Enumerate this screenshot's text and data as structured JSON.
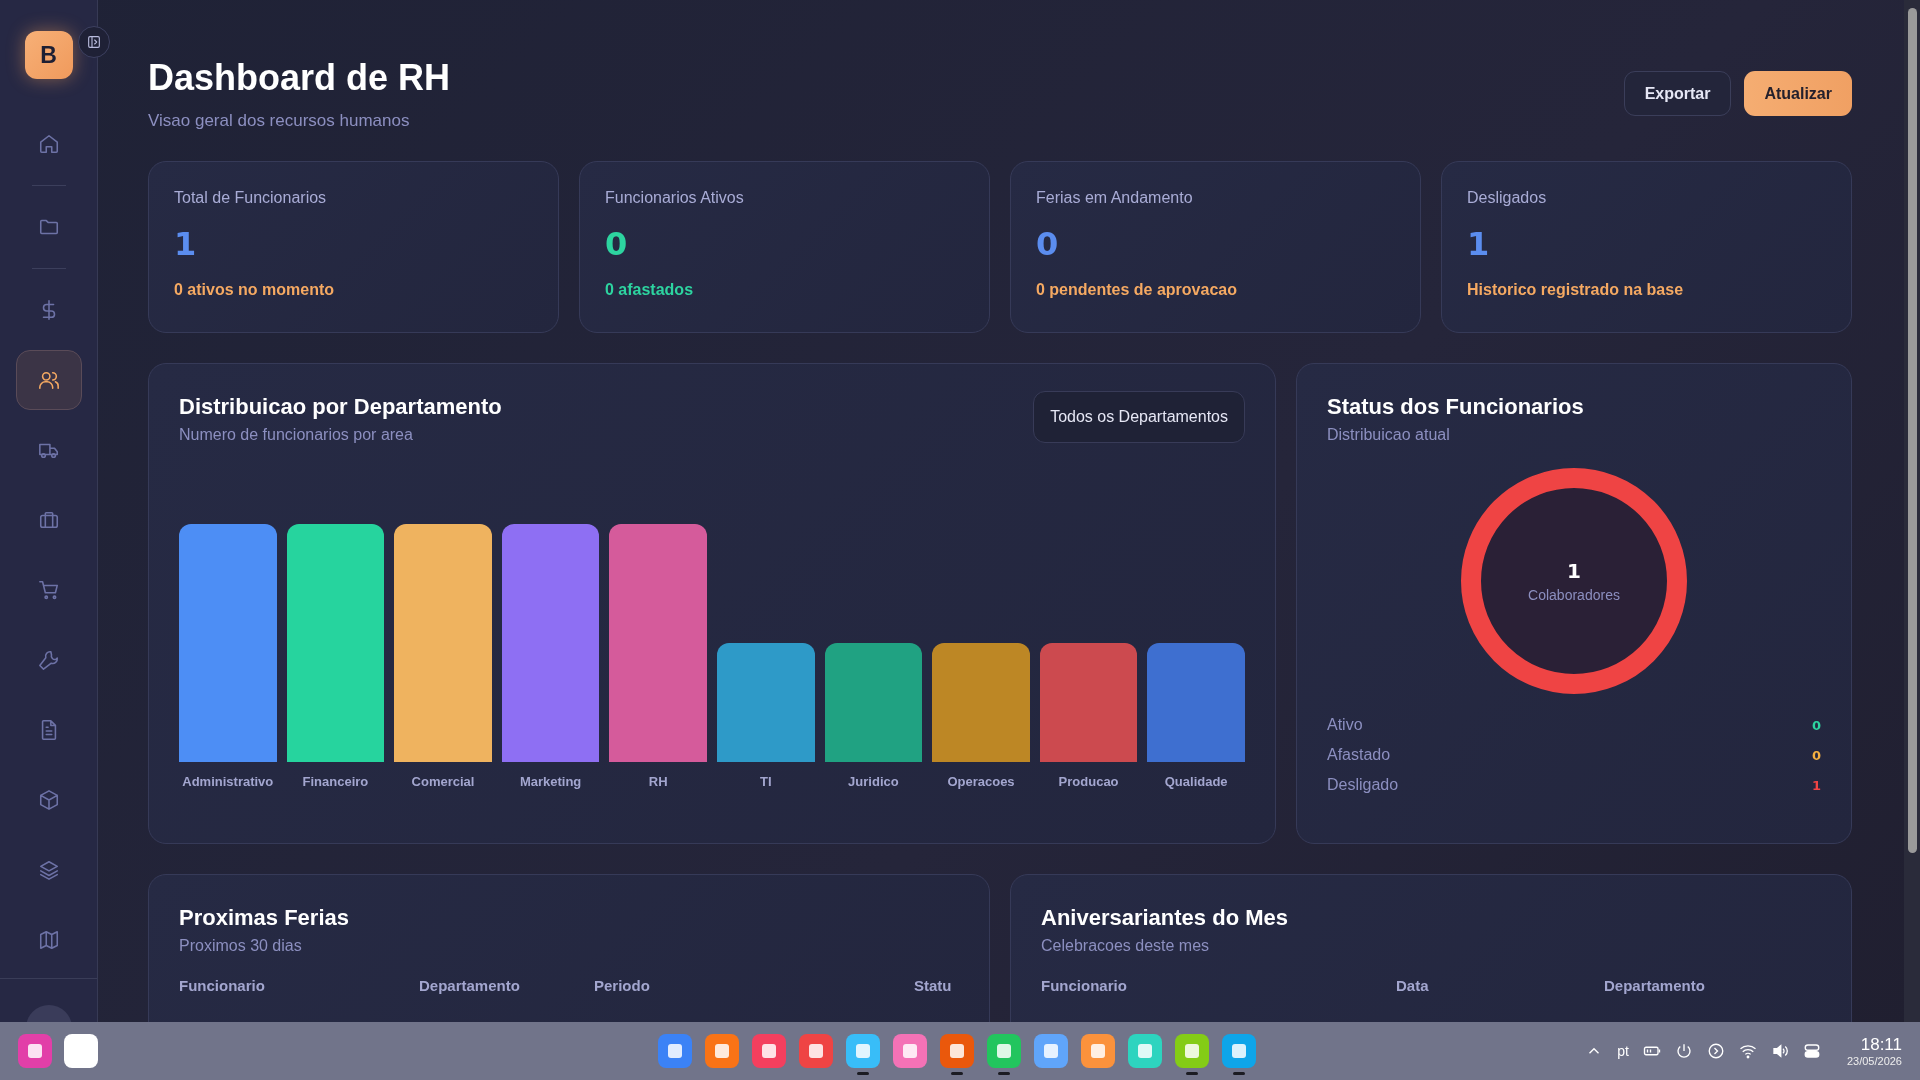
{
  "sidebar": {
    "logo": "B",
    "groups": [
      [
        {
          "kind": "home",
          "selected": false
        }
      ],
      [
        {
          "kind": "folder",
          "selected": false
        }
      ],
      [
        {
          "kind": "dollar",
          "selected": false
        },
        {
          "kind": "users",
          "selected": true
        },
        {
          "kind": "truck",
          "selected": false
        },
        {
          "kind": "briefcase",
          "selected": false
        },
        {
          "kind": "cart",
          "selected": false
        },
        {
          "kind": "wrench",
          "selected": false
        },
        {
          "kind": "document",
          "selected": false
        },
        {
          "kind": "box",
          "selected": false
        },
        {
          "kind": "layers",
          "selected": false
        },
        {
          "kind": "map",
          "selected": false
        }
      ]
    ]
  },
  "header": {
    "title": "Dashboard de RH",
    "subtitle": "Visao geral dos recursos humanos",
    "buttons": [
      {
        "label": "Exportar",
        "kind": "outline"
      },
      {
        "label": "Atualizar",
        "kind": "primary"
      }
    ]
  },
  "stats": [
    {
      "label": "Total de Funcionarios",
      "value": {
        "text": "1",
        "color": "#5b8def"
      },
      "note": {
        "text": "0 ativos no momento",
        "color": "#f5a962"
      }
    },
    {
      "label": "Funcionarios Ativos",
      "value": {
        "text": "0",
        "color": "#2dd4a0"
      },
      "note": {
        "text": "0 afastados",
        "color": "#2dd4a0"
      }
    },
    {
      "label": "Ferias em Andamento",
      "value": {
        "text": "0",
        "color": "#5b8def"
      },
      "note": {
        "text": "0 pendentes de aprovacao",
        "color": "#f5a962"
      }
    },
    {
      "label": "Desligados",
      "value": {
        "text": "1",
        "color": "#5b8def"
      },
      "note": {
        "text": "Historico registrado na base",
        "color": "#f5a962"
      }
    }
  ],
  "departments_card": {
    "title": "Distribuicao por Departamento",
    "subtitle": "Numero de funcionarios por area",
    "filter": "Todos os Departamentos",
    "departments": [
      {
        "name": "Administrativo",
        "color": "#4d8ef5",
        "tall": true
      },
      {
        "name": "Financeiro",
        "color": "#26d49e",
        "tall": true
      },
      {
        "name": "Comercial",
        "color": "#efb35f",
        "tall": true
      },
      {
        "name": "Marketing",
        "color": "#8e6ff3",
        "tall": true
      },
      {
        "name": "RH",
        "color": "#d55b9b",
        "tall": true
      },
      {
        "name": "TI",
        "color": "#2e9ac8",
        "tall": false
      },
      {
        "name": "Juridico",
        "color": "#20a282",
        "tall": false
      },
      {
        "name": "Operacoes",
        "color": "#bd8725",
        "tall": false
      },
      {
        "name": "Producao",
        "color": "#cc4a4f",
        "tall": false
      },
      {
        "name": "Qualidade",
        "color": "#3e6fd0",
        "tall": false
      }
    ]
  },
  "status_card": {
    "title": "Status dos Funcionarios",
    "subtitle": "Distribuicao atual",
    "total": "1",
    "total_label": "Colaboradores",
    "legend": [
      {
        "label": "Ativo",
        "value": "0",
        "color": "#2dd4a0"
      },
      {
        "label": "Afastado",
        "value": "0",
        "color": "#f5b041"
      },
      {
        "label": "Desligado",
        "value": "1",
        "color": "#ef4444"
      }
    ]
  },
  "vacations_card": {
    "title": "Proximas Ferias",
    "subtitle": "Proximos 30 dias",
    "columns": [
      "Funcionario",
      "Departamento",
      "Periodo",
      "Statu"
    ]
  },
  "birthdays_card": {
    "title": "Aniversariantes do Mes",
    "subtitle": "Celebracoes deste mes",
    "columns": [
      "Funcionario",
      "Data",
      "Departamento"
    ]
  },
  "taskbar": {
    "pinned": [
      {
        "color": "#e23fa8"
      },
      {
        "color": "#ffffff"
      }
    ],
    "apps": [
      {
        "color": "#3b82f6",
        "running": false
      },
      {
        "color": "#f97316",
        "running": false
      },
      {
        "color": "#f43f5e",
        "running": false
      },
      {
        "color": "#ef4444",
        "running": false
      },
      {
        "color": "#38bdf8",
        "running": true
      },
      {
        "color": "#f472b6",
        "running": false
      },
      {
        "color": "#ea580c",
        "running": true
      },
      {
        "color": "#22c55e",
        "running": true
      },
      {
        "color": "#60a5fa",
        "running": false
      },
      {
        "color": "#fb923c",
        "running": false
      },
      {
        "color": "#2dd4bf",
        "running": false
      },
      {
        "color": "#84cc16",
        "running": true
      },
      {
        "color": "#0ea5e9",
        "running": true
      }
    ],
    "language": "pt",
    "time": "18:11",
    "date": "23/05/2026"
  }
}
